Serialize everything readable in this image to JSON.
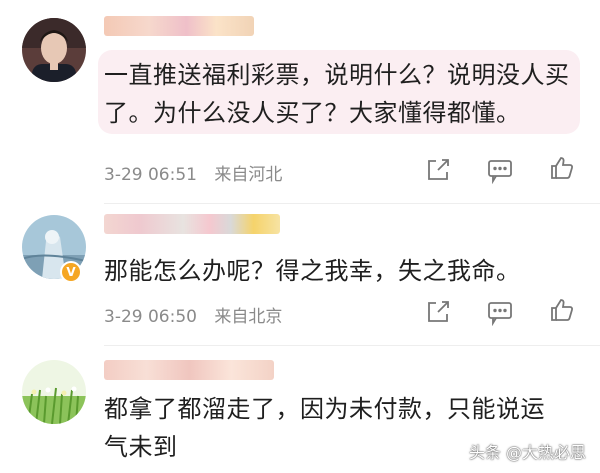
{
  "comments": [
    {
      "text": "一直推送福利彩票，说明什么？说明没人买了。为什么没人买了？大家懂得都懂。",
      "time": "3-29 06:51",
      "location": "来自河北"
    },
    {
      "text": "那能怎么办呢？得之我幸，失之我命。",
      "time": "3-29 06:50",
      "location": "来自北京"
    },
    {
      "text": "都拿了都溜走了，因为未付款，只能说运气未到"
    }
  ],
  "icons": {
    "share": "share-icon",
    "comment": "comment-icon",
    "like": "thumbs-up-icon",
    "verified": "verified-badge-icon"
  },
  "colors": {
    "highlight": "#fbeef2",
    "meta": "#8a8a8a",
    "badge": "#f5a623",
    "accent": "#f29b38"
  },
  "watermark": "头条 @大热必思"
}
